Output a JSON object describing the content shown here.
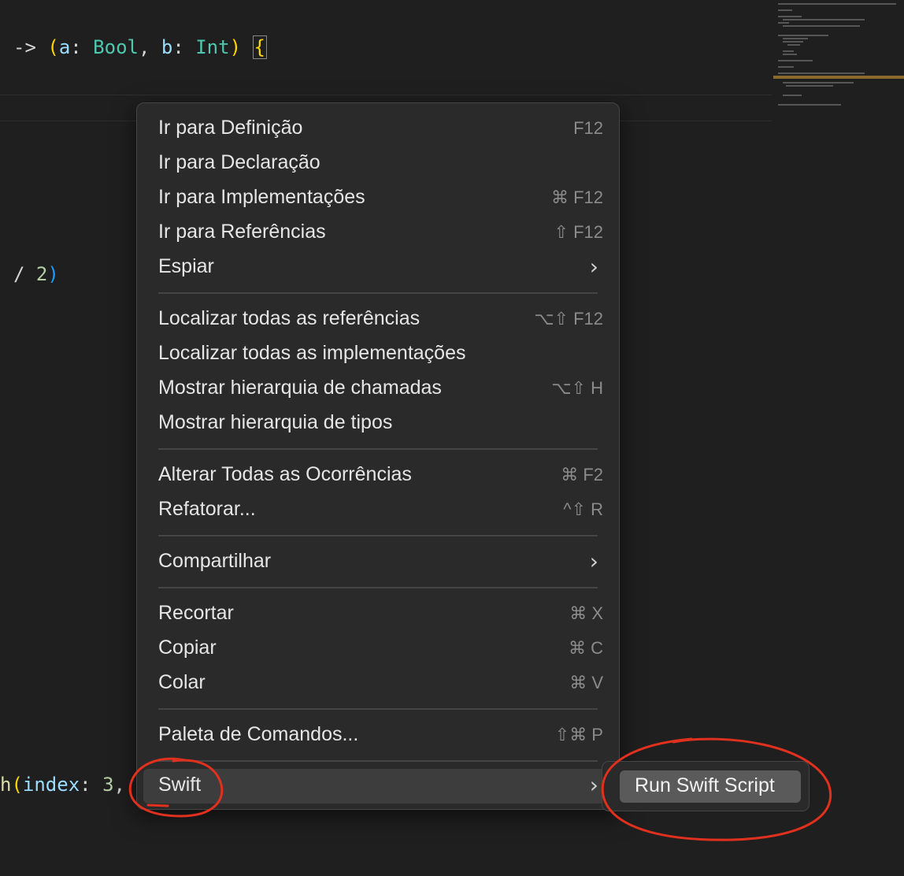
{
  "editor": {
    "line1": {
      "arrow": "->",
      "open": "(",
      "a": "a",
      "colon1": ": ",
      "type1": "Bool",
      "comma": ", ",
      "b": "b",
      "colon2": ": ",
      "type2": "Int",
      "close": ")",
      "brace": "{"
    },
    "line2": {
      "slash": "/ ",
      "num": "2",
      "close": ")"
    },
    "line3": {
      "fn": "h",
      "open": "(",
      "param": "index",
      "colon": ": ",
      "num": "3",
      "comma": ","
    }
  },
  "context_menu": {
    "groups": [
      [
        {
          "label": "Ir para Definição",
          "shortcut": "F12"
        },
        {
          "label": "Ir para Declaração",
          "shortcut": ""
        },
        {
          "label": "Ir para Implementações",
          "shortcut": "⌘ F12"
        },
        {
          "label": "Ir para Referências",
          "shortcut": "⇧ F12"
        },
        {
          "label": "Espiar",
          "submenu": true
        }
      ],
      [
        {
          "label": "Localizar todas as referências",
          "shortcut": "⌥⇧ F12"
        },
        {
          "label": "Localizar todas as implementações",
          "shortcut": ""
        },
        {
          "label": "Mostrar hierarquia de chamadas",
          "shortcut": "⌥⇧ H"
        },
        {
          "label": "Mostrar hierarquia de tipos",
          "shortcut": ""
        }
      ],
      [
        {
          "label": "Alterar Todas as Ocorrências",
          "shortcut": "⌘ F2"
        },
        {
          "label": "Refatorar...",
          "shortcut": "^⇧ R"
        }
      ],
      [
        {
          "label": "Compartilhar",
          "submenu": true
        }
      ],
      [
        {
          "label": "Recortar",
          "shortcut": "⌘ X"
        },
        {
          "label": "Copiar",
          "shortcut": "⌘ C"
        },
        {
          "label": "Colar",
          "shortcut": "⌘ V"
        }
      ],
      [
        {
          "label": "Paleta de Comandos...",
          "shortcut": "⇧⌘ P"
        }
      ],
      [
        {
          "label": "Swift",
          "submenu": true,
          "active": true
        }
      ]
    ]
  },
  "submenu": {
    "label": "Run Swift Script"
  },
  "icons": {
    "submenu_arrow": "chevron-right-icon"
  },
  "colors": {
    "annotation": "#e0301e",
    "menu_bg": "#2a2a2a",
    "highlight": "#3d3d3d"
  }
}
